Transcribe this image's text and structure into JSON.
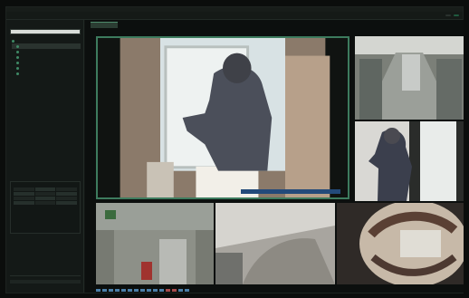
{
  "window": {
    "title": ""
  },
  "menu": {
    "items": [
      "",
      "",
      "",
      ""
    ]
  },
  "status": {
    "pill1": "",
    "pill2": ""
  },
  "sidebar": {
    "panel_title": "",
    "search_placeholder": "",
    "tree": [
      {
        "label": "",
        "level": 0,
        "selected": false
      },
      {
        "label": "",
        "level": 1,
        "selected": true
      },
      {
        "label": "",
        "level": 1,
        "selected": false
      },
      {
        "label": "",
        "level": 1,
        "selected": false
      },
      {
        "label": "",
        "level": 1,
        "selected": false
      },
      {
        "label": "",
        "level": 1,
        "selected": false
      },
      {
        "label": "",
        "level": 1,
        "selected": false
      }
    ],
    "group_title": "",
    "bottom_label": ""
  },
  "main": {
    "tab_label": "",
    "alert_text": "",
    "camera_labels": [
      "",
      "",
      "",
      "",
      "",
      ""
    ]
  },
  "colors": {
    "accent": "#3d7b5e",
    "alert": "#234a7a",
    "background": "#0b0d0c"
  },
  "icons": {
    "tree_node": "camera-dot-icon"
  }
}
